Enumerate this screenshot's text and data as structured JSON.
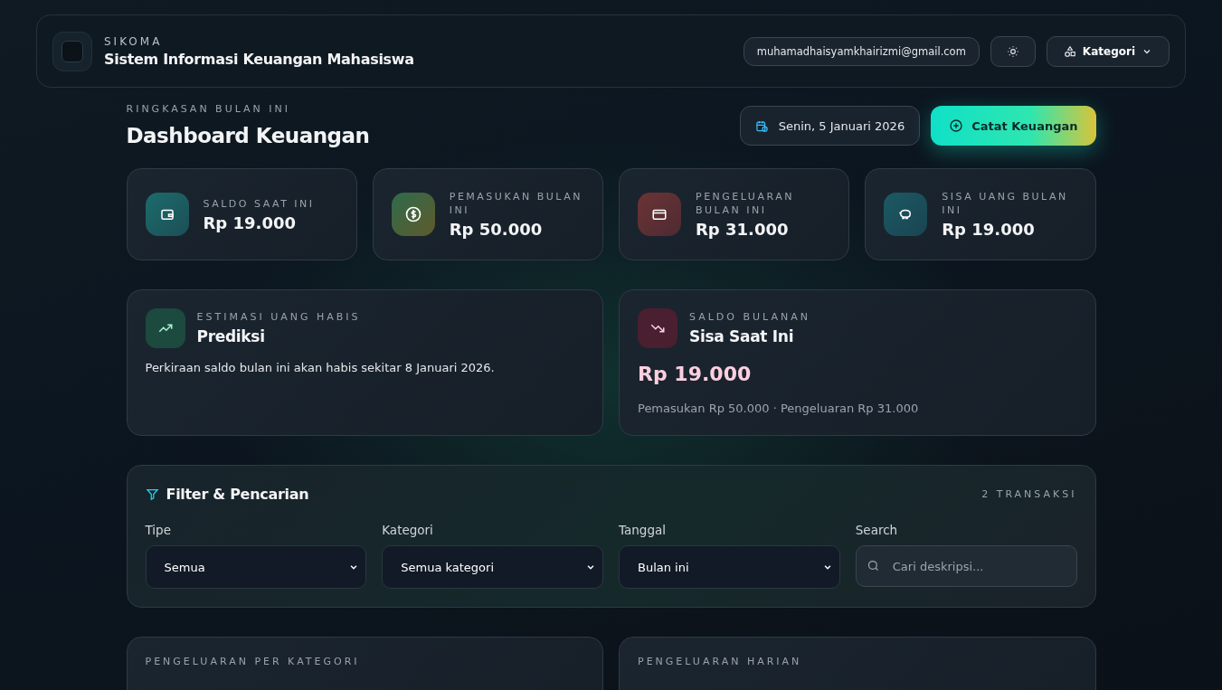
{
  "header": {
    "brand": "SIKOMA",
    "title": "Sistem Informasi Keuangan Mahasiswa",
    "email": "muhamadhaisyamkhairizmi@gmail.com",
    "menu_label": "Kategori"
  },
  "page": {
    "eyebrow": "RINGKASAN BULAN INI",
    "title": "Dashboard Keuangan",
    "date": "Senin, 5 Januari 2026",
    "primary_button": "Catat Keuangan"
  },
  "stats": [
    {
      "kind": "wallet",
      "label": "SALDO SAAT INI",
      "value": "Rp 19.000"
    },
    {
      "kind": "income",
      "label": "PEMASUKAN BULAN INI",
      "value": "Rp 50.000"
    },
    {
      "kind": "expense",
      "label": "PENGELUARAN BULAN INI",
      "value": "Rp 31.000"
    },
    {
      "kind": "savings",
      "label": "SISA UANG BULAN INI",
      "value": "Rp 19.000"
    }
  ],
  "insights": [
    {
      "kind": "trend-up",
      "eyebrow": "ESTIMASI UANG HABIS",
      "title": "Prediksi",
      "text": "Perkiraan saldo bulan ini akan habis sekitar 8 Januari 2026."
    },
    {
      "kind": "trend-down",
      "eyebrow": "SALDO BULANAN",
      "title": "Sisa Saat Ini",
      "amount": "Rp 19.000",
      "text": "Pemasukan Rp 50.000 · Pengeluaran Rp 31.000"
    }
  ],
  "filter": {
    "title": "Filter & Pencarian",
    "count": "2 TRANSAKSI",
    "fields": [
      {
        "kind": "select",
        "label": "Tipe",
        "value": "Semua"
      },
      {
        "kind": "select",
        "label": "Kategori",
        "value": "Semua kategori"
      },
      {
        "kind": "select",
        "label": "Tanggal",
        "value": "Bulan ini"
      },
      {
        "kind": "search",
        "label": "Search",
        "placeholder": "Cari deskripsi..."
      }
    ]
  },
  "bottom_cards": [
    {
      "eyebrow": "PENGELUARAN PER KATEGORI"
    },
    {
      "eyebrow": "PENGELUARAN HARIAN"
    }
  ]
}
